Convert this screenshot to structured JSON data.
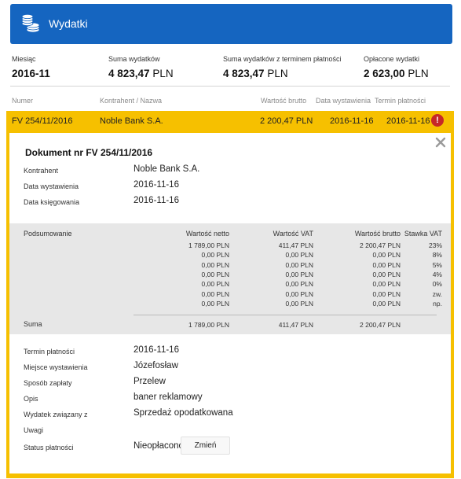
{
  "header": {
    "title": "Wydatki",
    "icon": "coins-icon"
  },
  "summary": [
    {
      "label": "Miesiąc",
      "value": "2016-11",
      "bold": true
    },
    {
      "label": "Suma wydatków",
      "value_bold": "4 823,47",
      "value_unit": "PLN"
    },
    {
      "label": "Suma wydatków z terminem płatności",
      "value_bold": "4 823,47",
      "value_unit": "PLN"
    },
    {
      "label": "Opłacone wydatki",
      "value_bold": "2 623,00",
      "value_unit": "PLN"
    }
  ],
  "columns": [
    "Numer",
    "Kontrahent / Nazwa",
    "Wartość brutto",
    "Data wystawienia",
    "Termin płatności"
  ],
  "invoice_row": {
    "number": "FV 254/11/2016",
    "contractor": "Noble Bank S.A.",
    "gross": "2 200,47 PLN",
    "issue_date": "2016-11-16",
    "due_date": "2016-11-16",
    "alert": "!",
    "accent_color": "#f6c000"
  },
  "document": {
    "title": "Dokument nr FV 254/11/2016",
    "fields_top": [
      {
        "label": "Kontrahent",
        "value": "Noble Bank S.A."
      },
      {
        "label": "Data wystawienia",
        "value": "2016-11-16"
      },
      {
        "label": "Data księgowania",
        "value": "2016-11-16"
      }
    ],
    "summary_table": {
      "row_label": "Podsumowanie",
      "headers": [
        "Wartość netto",
        "Wartość VAT",
        "Wartość brutto",
        "Stawka VAT"
      ],
      "rows": [
        [
          "1 789,00 PLN",
          "411,47 PLN",
          "2 200,47 PLN",
          "23%"
        ],
        [
          "0,00 PLN",
          "0,00 PLN",
          "0,00 PLN",
          "8%"
        ],
        [
          "0,00 PLN",
          "0,00 PLN",
          "0,00 PLN",
          "5%"
        ],
        [
          "0,00 PLN",
          "0,00 PLN",
          "0,00 PLN",
          "4%"
        ],
        [
          "0,00 PLN",
          "0,00 PLN",
          "0,00 PLN",
          "0%"
        ],
        [
          "0,00 PLN",
          "0,00 PLN",
          "0,00 PLN",
          "zw."
        ],
        [
          "0,00 PLN",
          "0,00 PLN",
          "0,00 PLN",
          "np."
        ]
      ],
      "total_label": "Suma",
      "totals": [
        "1 789,00 PLN",
        "411,47 PLN",
        "2 200,47 PLN"
      ]
    },
    "fields_bottom": [
      {
        "label": "Termin płatności",
        "value": "2016-11-16"
      },
      {
        "label": "Miejsce wystawienia",
        "value": "Józefosław"
      },
      {
        "label": "Sposób zapłaty",
        "value": "Przelew"
      },
      {
        "label": "Opis",
        "value": "baner reklamowy"
      },
      {
        "label": "Wydatek związany z",
        "value": "Sprzedaż opodatkowana"
      },
      {
        "label": "Uwagi",
        "value": ""
      }
    ],
    "payment_status": {
      "label": "Status płatności",
      "value": "Nieopłacono",
      "button": "Zmień"
    }
  },
  "colors": {
    "header": "#1565c0",
    "accent": "#f6c000",
    "alert": "#c62828"
  }
}
